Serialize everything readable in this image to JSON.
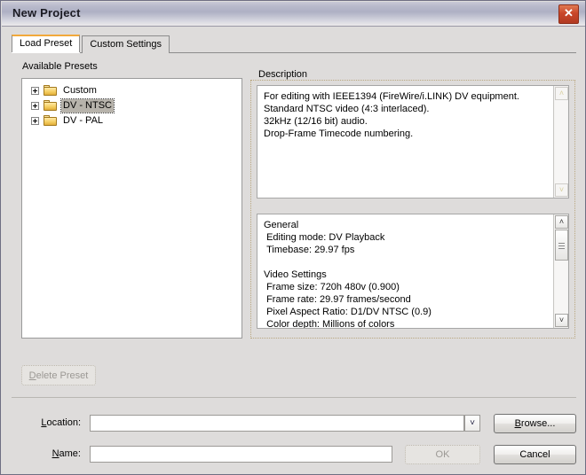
{
  "window": {
    "title": "New Project",
    "close_icon": "close-x-icon"
  },
  "tabs": [
    {
      "label": "Load Preset",
      "active": true
    },
    {
      "label": "Custom Settings",
      "active": false
    }
  ],
  "presets_group": {
    "label": "Available Presets",
    "items": [
      {
        "label": "Custom",
        "icon": "folder-icon",
        "expander": "plus-icon",
        "selected": false
      },
      {
        "label": "DV - NTSC",
        "icon": "folder-icon",
        "expander": "plus-icon",
        "selected": true
      },
      {
        "label": "DV - PAL",
        "icon": "folder-icon",
        "expander": "plus-icon",
        "selected": false
      }
    ]
  },
  "description_group": {
    "label": "Description",
    "text": "For editing with IEEE1394 (FireWire/i.LINK) DV equipment.\nStandard NTSC video (4:3 interlaced).\n32kHz (12/16 bit) audio.\nDrop-Frame Timecode numbering.",
    "scrollbar": {
      "up_icon": "chevron-up-icon",
      "down_icon": "chevron-down-icon",
      "up_glyph": "˄",
      "down_glyph": "˅",
      "enabled": false
    }
  },
  "settings_panel": {
    "text": "General\n Editing mode: DV Playback\n Timebase: 29.97 fps\n\nVideo Settings\n Frame size: 720h 480v (0.900)\n Frame rate: 29.97 frames/second\n Pixel Aspect Ratio: D1/DV NTSC (0.9)\n Color depth: Millions of colors",
    "scrollbar": {
      "up_icon": "chevron-up-icon",
      "down_icon": "chevron-down-icon",
      "up_glyph": "˄",
      "down_glyph": "˅",
      "enabled": true
    }
  },
  "delete_preset_button": {
    "label": "Delete Preset",
    "accel": "D",
    "rest": "elete Preset",
    "enabled": false
  },
  "location": {
    "label_accel": "L",
    "label_rest": "ocation:",
    "value": "",
    "placeholder": "",
    "dropdown_icon": "chevron-down-icon",
    "dropdown_glyph": "˅"
  },
  "name": {
    "label_accel": "N",
    "label_rest": "ame:",
    "value": "",
    "placeholder": ""
  },
  "buttons": {
    "browse": {
      "accel": "B",
      "rest": "rowse...",
      "enabled": true
    },
    "ok": {
      "label": "OK",
      "enabled": false
    },
    "cancel": {
      "label": "Cancel",
      "enabled": true
    }
  },
  "colors": {
    "dialog_bg": "#dedcdb",
    "accent_tab": "#f2a93b",
    "close_button": "#c9462a",
    "selection": "#b7b3ab",
    "panel_bg": "#ffffff"
  }
}
